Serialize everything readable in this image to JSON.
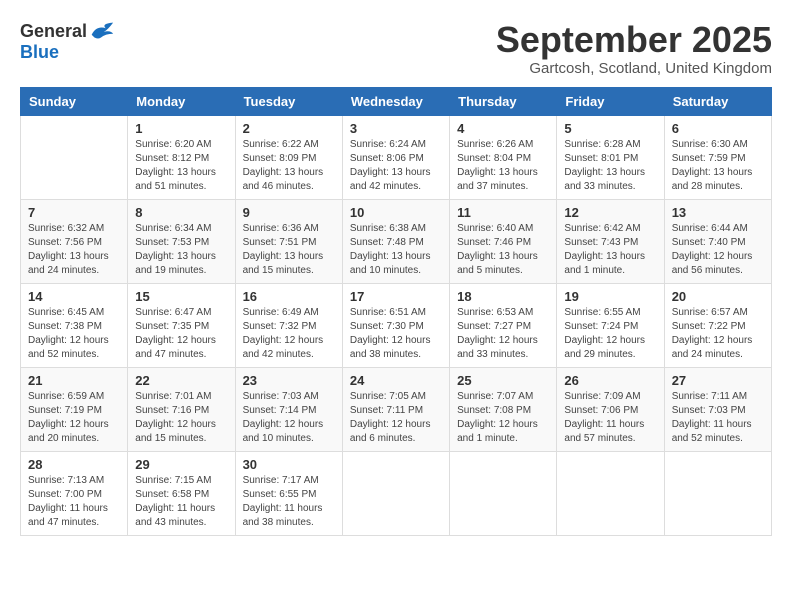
{
  "header": {
    "logo_general": "General",
    "logo_blue": "Blue",
    "month_title": "September 2025",
    "location": "Gartcosh, Scotland, United Kingdom"
  },
  "weekdays": [
    "Sunday",
    "Monday",
    "Tuesday",
    "Wednesday",
    "Thursday",
    "Friday",
    "Saturday"
  ],
  "weeks": [
    [
      {
        "day": "",
        "info": ""
      },
      {
        "day": "1",
        "info": "Sunrise: 6:20 AM\nSunset: 8:12 PM\nDaylight: 13 hours\nand 51 minutes."
      },
      {
        "day": "2",
        "info": "Sunrise: 6:22 AM\nSunset: 8:09 PM\nDaylight: 13 hours\nand 46 minutes."
      },
      {
        "day": "3",
        "info": "Sunrise: 6:24 AM\nSunset: 8:06 PM\nDaylight: 13 hours\nand 42 minutes."
      },
      {
        "day": "4",
        "info": "Sunrise: 6:26 AM\nSunset: 8:04 PM\nDaylight: 13 hours\nand 37 minutes."
      },
      {
        "day": "5",
        "info": "Sunrise: 6:28 AM\nSunset: 8:01 PM\nDaylight: 13 hours\nand 33 minutes."
      },
      {
        "day": "6",
        "info": "Sunrise: 6:30 AM\nSunset: 7:59 PM\nDaylight: 13 hours\nand 28 minutes."
      }
    ],
    [
      {
        "day": "7",
        "info": "Sunrise: 6:32 AM\nSunset: 7:56 PM\nDaylight: 13 hours\nand 24 minutes."
      },
      {
        "day": "8",
        "info": "Sunrise: 6:34 AM\nSunset: 7:53 PM\nDaylight: 13 hours\nand 19 minutes."
      },
      {
        "day": "9",
        "info": "Sunrise: 6:36 AM\nSunset: 7:51 PM\nDaylight: 13 hours\nand 15 minutes."
      },
      {
        "day": "10",
        "info": "Sunrise: 6:38 AM\nSunset: 7:48 PM\nDaylight: 13 hours\nand 10 minutes."
      },
      {
        "day": "11",
        "info": "Sunrise: 6:40 AM\nSunset: 7:46 PM\nDaylight: 13 hours\nand 5 minutes."
      },
      {
        "day": "12",
        "info": "Sunrise: 6:42 AM\nSunset: 7:43 PM\nDaylight: 13 hours\nand 1 minute."
      },
      {
        "day": "13",
        "info": "Sunrise: 6:44 AM\nSunset: 7:40 PM\nDaylight: 12 hours\nand 56 minutes."
      }
    ],
    [
      {
        "day": "14",
        "info": "Sunrise: 6:45 AM\nSunset: 7:38 PM\nDaylight: 12 hours\nand 52 minutes."
      },
      {
        "day": "15",
        "info": "Sunrise: 6:47 AM\nSunset: 7:35 PM\nDaylight: 12 hours\nand 47 minutes."
      },
      {
        "day": "16",
        "info": "Sunrise: 6:49 AM\nSunset: 7:32 PM\nDaylight: 12 hours\nand 42 minutes."
      },
      {
        "day": "17",
        "info": "Sunrise: 6:51 AM\nSunset: 7:30 PM\nDaylight: 12 hours\nand 38 minutes."
      },
      {
        "day": "18",
        "info": "Sunrise: 6:53 AM\nSunset: 7:27 PM\nDaylight: 12 hours\nand 33 minutes."
      },
      {
        "day": "19",
        "info": "Sunrise: 6:55 AM\nSunset: 7:24 PM\nDaylight: 12 hours\nand 29 minutes."
      },
      {
        "day": "20",
        "info": "Sunrise: 6:57 AM\nSunset: 7:22 PM\nDaylight: 12 hours\nand 24 minutes."
      }
    ],
    [
      {
        "day": "21",
        "info": "Sunrise: 6:59 AM\nSunset: 7:19 PM\nDaylight: 12 hours\nand 20 minutes."
      },
      {
        "day": "22",
        "info": "Sunrise: 7:01 AM\nSunset: 7:16 PM\nDaylight: 12 hours\nand 15 minutes."
      },
      {
        "day": "23",
        "info": "Sunrise: 7:03 AM\nSunset: 7:14 PM\nDaylight: 12 hours\nand 10 minutes."
      },
      {
        "day": "24",
        "info": "Sunrise: 7:05 AM\nSunset: 7:11 PM\nDaylight: 12 hours\nand 6 minutes."
      },
      {
        "day": "25",
        "info": "Sunrise: 7:07 AM\nSunset: 7:08 PM\nDaylight: 12 hours\nand 1 minute."
      },
      {
        "day": "26",
        "info": "Sunrise: 7:09 AM\nSunset: 7:06 PM\nDaylight: 11 hours\nand 57 minutes."
      },
      {
        "day": "27",
        "info": "Sunrise: 7:11 AM\nSunset: 7:03 PM\nDaylight: 11 hours\nand 52 minutes."
      }
    ],
    [
      {
        "day": "28",
        "info": "Sunrise: 7:13 AM\nSunset: 7:00 PM\nDaylight: 11 hours\nand 47 minutes."
      },
      {
        "day": "29",
        "info": "Sunrise: 7:15 AM\nSunset: 6:58 PM\nDaylight: 11 hours\nand 43 minutes."
      },
      {
        "day": "30",
        "info": "Sunrise: 7:17 AM\nSunset: 6:55 PM\nDaylight: 11 hours\nand 38 minutes."
      },
      {
        "day": "",
        "info": ""
      },
      {
        "day": "",
        "info": ""
      },
      {
        "day": "",
        "info": ""
      },
      {
        "day": "",
        "info": ""
      }
    ]
  ]
}
